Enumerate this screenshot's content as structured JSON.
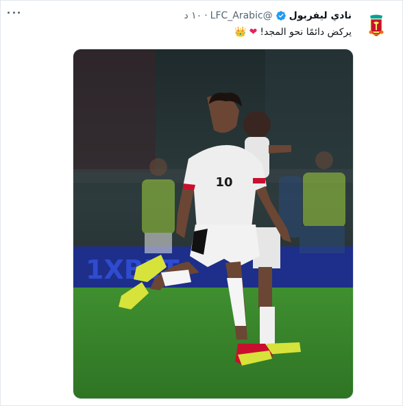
{
  "tweet": {
    "display_name": "نادي ليفربول",
    "handle": "@LFC_Arabic",
    "separator": "·",
    "time": "١٠ د",
    "text": "يركض دائمًا نحو المجد!",
    "emoji_heart": "❤",
    "emoji_crown": "👑",
    "more_label": "More",
    "shirt_number": "10",
    "board_text": "1XBET",
    "avatar_crest_text": "LIVERPOOL"
  },
  "colors": {
    "verified": "#1d9bf0",
    "liverpool_red": "#c8102e",
    "pitch": "#3d8a2e",
    "kit": "#eeeeee"
  },
  "icons": {
    "more": "more-horizontal-icon",
    "verified": "verified-badge-icon",
    "avatar": "liverpool-crest-icon"
  }
}
